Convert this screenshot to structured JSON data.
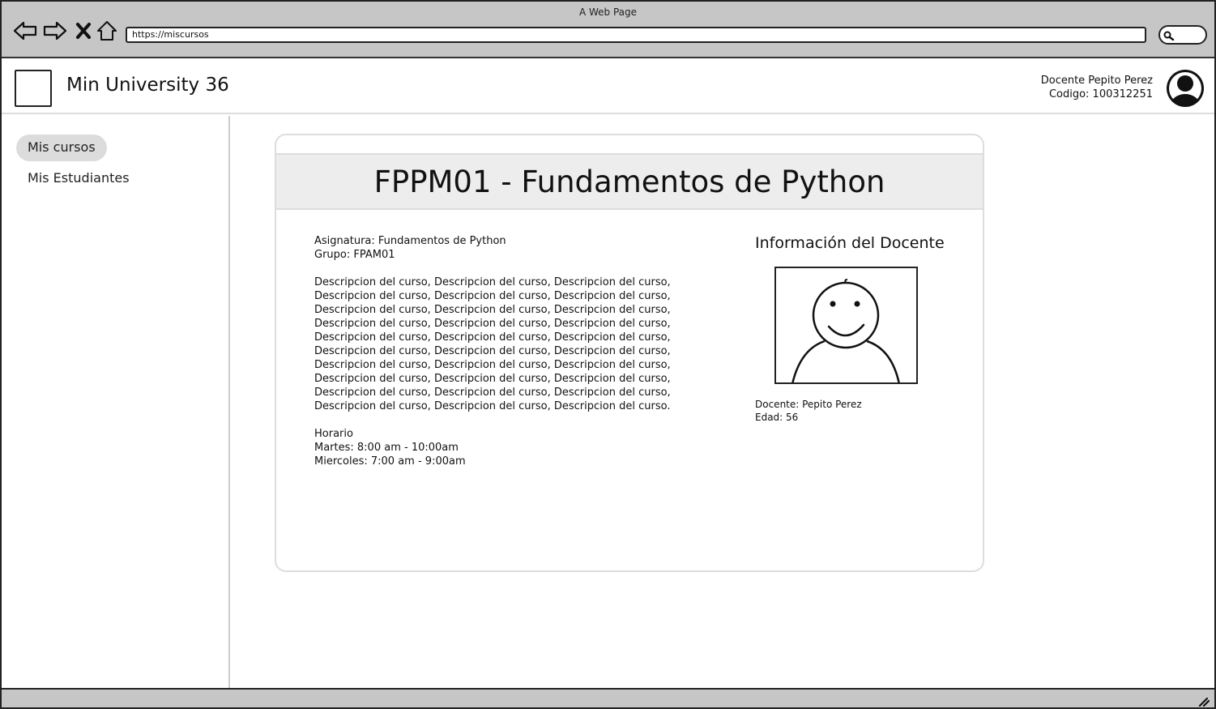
{
  "window": {
    "title": "A Web Page",
    "url": "https://miscursos"
  },
  "header": {
    "app_title": "Min University 36",
    "user_name": "Docente Pepito Perez",
    "user_code": "Codigo: 100312251"
  },
  "sidebar": {
    "items": [
      {
        "label": "Mis cursos",
        "active": true
      },
      {
        "label": "Mis Estudiantes",
        "active": false
      }
    ]
  },
  "course": {
    "title": "FPPM01 - Fundamentos de Python",
    "subject": "Asignatura: Fundamentos de Python",
    "group": "Grupo: FPAM01",
    "description_lines": [
      "Descripcion del curso, Descripcion del curso, Descripcion del curso,",
      "Descripcion del curso, Descripcion del curso, Descripcion del curso,",
      "Descripcion del curso, Descripcion del curso, Descripcion del curso,",
      "Descripcion del curso, Descripcion del curso, Descripcion del curso,",
      "Descripcion del curso, Descripcion del curso, Descripcion del curso,",
      "Descripcion del curso, Descripcion del curso, Descripcion del curso,",
      "Descripcion del curso, Descripcion del curso, Descripcion del curso,",
      "Descripcion del curso, Descripcion del curso, Descripcion del curso,",
      "Descripcion del curso, Descripcion del curso, Descripcion del curso,",
      "Descripcion del curso, Descripcion del curso, Descripcion del curso."
    ],
    "schedule_title": "Horario",
    "schedule": [
      "Martes: 8:00 am - 10:00am",
      "Miercoles: 7:00 am - 9:00am"
    ]
  },
  "teacher": {
    "heading": "Información del Docente",
    "name": "Docente: Pepito Perez",
    "age": "Edad: 56"
  },
  "icons": {
    "back": "back-arrow-icon",
    "forward": "forward-arrow-icon",
    "stop": "close-icon",
    "home": "home-icon",
    "search": "search-icon",
    "avatar": "user-avatar-icon",
    "resize": "resize-grip-icon"
  }
}
